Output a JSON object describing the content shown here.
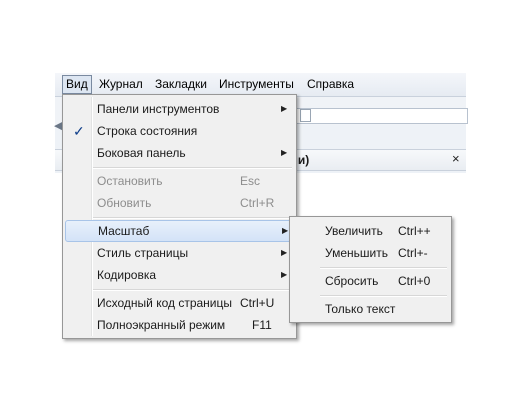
{
  "menubar": {
    "items": [
      "Вид",
      "Журнал",
      "Закладки",
      "Инструменты",
      "Справка"
    ]
  },
  "sidebar": {
    "title": "ени)",
    "close": "×"
  },
  "view_menu": {
    "items": [
      {
        "label": "Панели инструментов",
        "submenu": true
      },
      {
        "label": "Строка состояния",
        "checked": true
      },
      {
        "label": "Боковая панель",
        "submenu": true
      },
      {
        "label": "Остановить",
        "shortcut": "Esc",
        "disabled": true
      },
      {
        "label": "Обновить",
        "shortcut": "Ctrl+R",
        "disabled": true
      },
      {
        "label": "Масштаб",
        "submenu": true,
        "highlighted": true
      },
      {
        "label": "Стиль страницы",
        "submenu": true
      },
      {
        "label": "Кодировка",
        "submenu": true
      },
      {
        "label": "Исходный код страницы",
        "shortcut": "Ctrl+U"
      },
      {
        "label": "Полноэкранный режим",
        "shortcut": "F11"
      }
    ]
  },
  "zoom_menu": {
    "items": [
      {
        "label": "Увеличить",
        "shortcut": "Ctrl++"
      },
      {
        "label": "Уменьшить",
        "shortcut": "Ctrl+-"
      },
      {
        "label": "Сбросить",
        "shortcut": "Ctrl+0"
      },
      {
        "label": "Только текст"
      }
    ]
  },
  "glyphs": {
    "check": "✓",
    "arrow": "▶"
  }
}
